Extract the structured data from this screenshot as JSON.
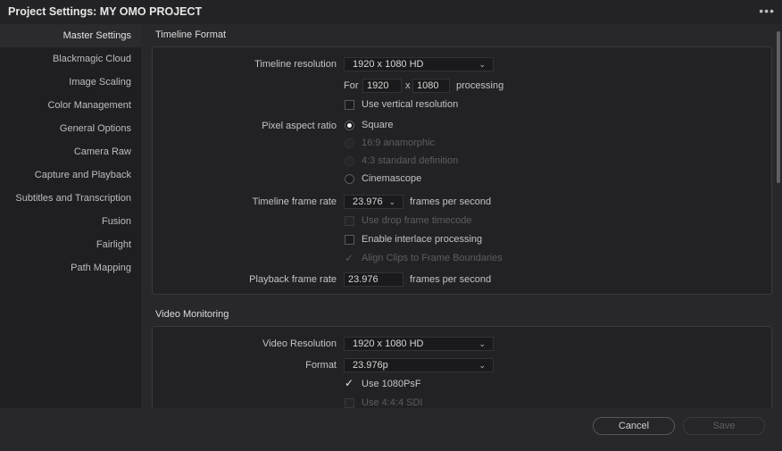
{
  "window": {
    "title": "Project Settings:  MY OMO PROJECT",
    "menu_icon": "more-dots-icon"
  },
  "sidebar": {
    "items": [
      {
        "label": "Master Settings",
        "active": true
      },
      {
        "label": "Blackmagic Cloud"
      },
      {
        "label": "Image Scaling"
      },
      {
        "label": "Color Management"
      },
      {
        "label": "General Options"
      },
      {
        "label": "Camera Raw"
      },
      {
        "label": "Capture and Playback"
      },
      {
        "label": "Subtitles and Transcription"
      },
      {
        "label": "Fusion"
      },
      {
        "label": "Fairlight"
      },
      {
        "label": "Path Mapping"
      }
    ]
  },
  "timeline_format": {
    "section_title": "Timeline Format",
    "timeline_resolution_label": "Timeline resolution",
    "timeline_resolution_value": "1920 x 1080 HD",
    "for_label": "For",
    "width_value": "1920",
    "x_label": "x",
    "height_value": "1080",
    "processing_label": "processing",
    "use_vertical_label": "Use vertical resolution",
    "pixel_aspect_label": "Pixel aspect ratio",
    "pixel_aspect_options": [
      "Square",
      "16:9 anamorphic",
      "4:3 standard definition",
      "Cinemascope"
    ],
    "pixel_aspect_selected": "Square",
    "frame_rate_label": "Timeline frame rate",
    "frame_rate_value": "23.976",
    "fps_label": "frames per second",
    "drop_frame_label": "Use drop frame timecode",
    "interlace_label": "Enable interlace processing",
    "align_clips_label": "Align Clips to Frame Boundaries",
    "playback_rate_label": "Playback frame rate",
    "playback_rate_value": "23.976",
    "playback_fps_label": "frames per second"
  },
  "video_monitoring": {
    "section_title": "Video Monitoring",
    "video_resolution_label": "Video Resolution",
    "video_resolution_value": "1920 x 1080 HD",
    "format_label": "Format",
    "format_value": "23.976p",
    "use_1080psf_label": "Use 1080PsF",
    "use_1080psf_checked": true,
    "use_444_label": "Use 4:4:4 SDI"
  },
  "footer": {
    "cancel_label": "Cancel",
    "save_label": "Save"
  },
  "colors": {
    "background": "#1f1f22",
    "panel": "#222225",
    "text": "#cfcfcf",
    "disabled_text": "#5d5d60"
  }
}
